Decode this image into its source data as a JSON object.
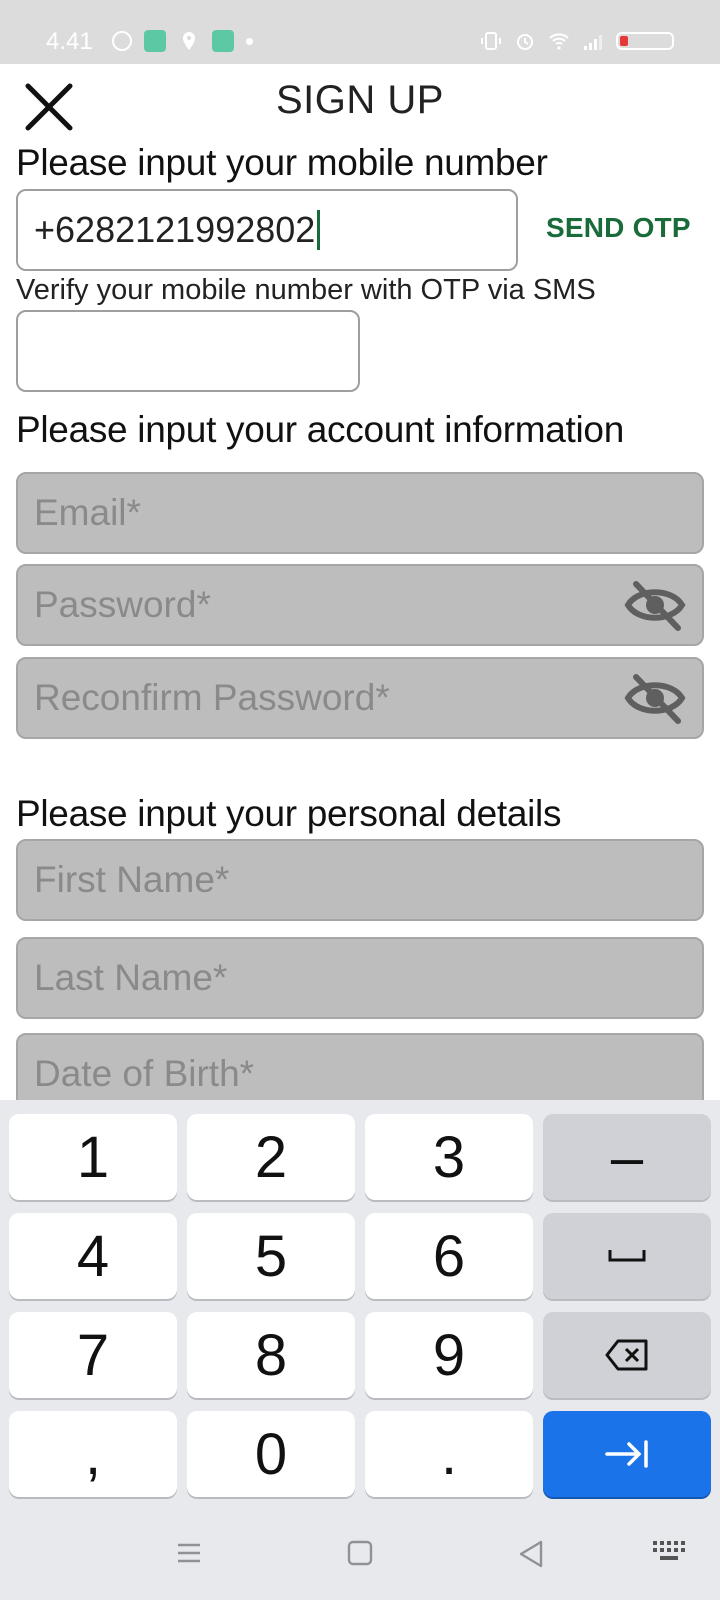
{
  "status_bar": {
    "time": "4.41"
  },
  "header": {
    "title": "SIGN UP"
  },
  "mobile_section": {
    "label": "Please input your mobile number",
    "phone_value": "+6282121992802",
    "send_otp": "SEND OTP",
    "otp_helper": "Verify your mobile number with OTP via SMS",
    "otp_value": ""
  },
  "account_section": {
    "label": "Please input your account information",
    "email_placeholder": "Email*",
    "password_placeholder": "Password*",
    "reconfirm_placeholder": "Reconfirm Password*"
  },
  "personal_section": {
    "label": "Please input your personal details",
    "first_name_placeholder": "First Name*",
    "last_name_placeholder": "Last Name*",
    "dob_placeholder": "Date of Birth*"
  },
  "keyboard": {
    "keys": [
      "1",
      "2",
      "3",
      "–",
      "4",
      "5",
      "6",
      "␣",
      "7",
      "8",
      "9",
      "⌫",
      ",",
      "0",
      ".",
      "→|"
    ]
  },
  "colors": {
    "accent_green": "#1a6b3a",
    "keyboard_go": "#1a73e8",
    "field_grey": "#bdbdbd"
  }
}
